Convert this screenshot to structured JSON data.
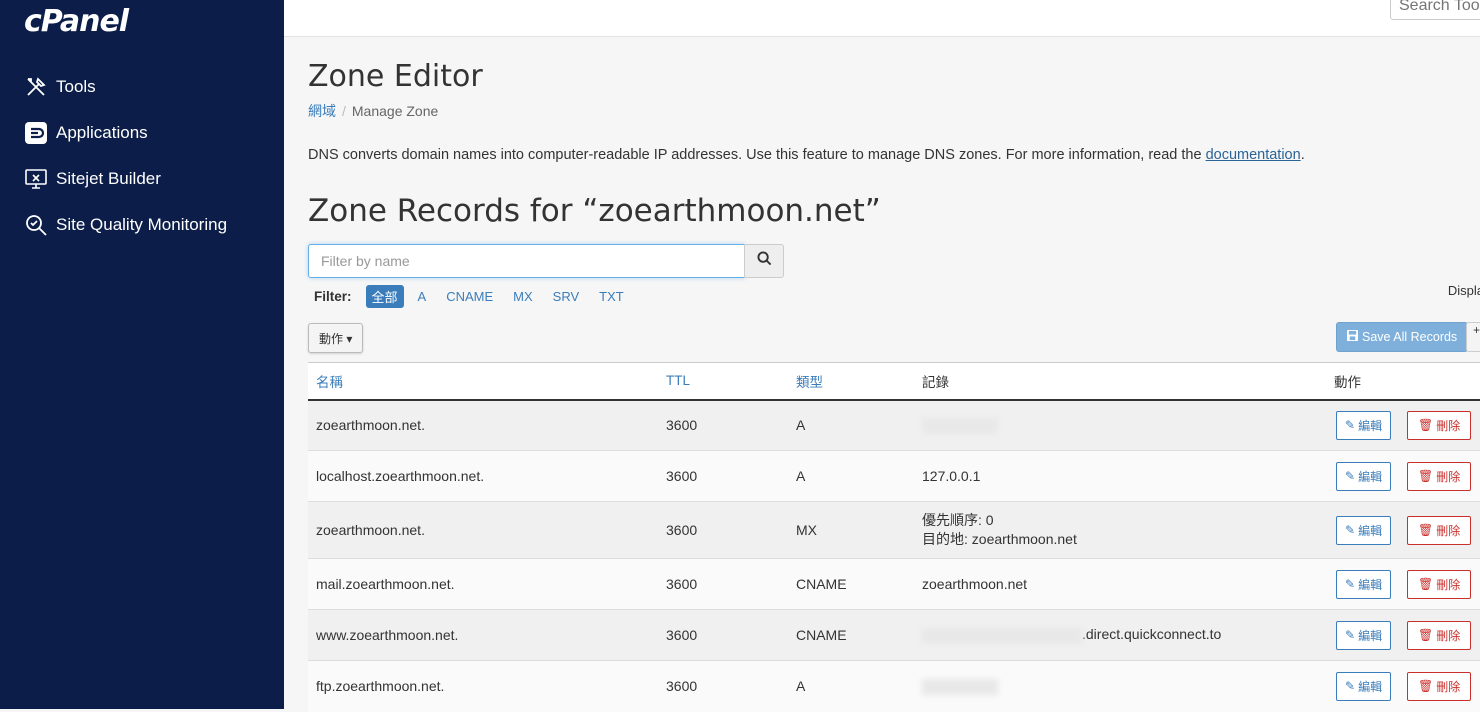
{
  "sidebar": {
    "logo": "cPanel",
    "items": [
      {
        "label": "Tools",
        "icon": "tools-icon"
      },
      {
        "label": "Applications",
        "icon": "applications-icon"
      },
      {
        "label": "Sitejet Builder",
        "icon": "sitejet-icon"
      },
      {
        "label": "Site Quality Monitoring",
        "icon": "site-quality-icon"
      }
    ]
  },
  "topbar": {
    "search_placeholder": "Search Tools"
  },
  "page": {
    "title": "Zone Editor",
    "breadcrumb": {
      "parent": "網域",
      "current": "Manage Zone"
    },
    "description": "DNS converts domain names into computer-readable IP addresses. Use this feature to manage DNS zones. For more information, read the ",
    "doc_link": "documentation",
    "desc_end": ".",
    "zone_title": "Zone Records for “zoearthmoon.net”"
  },
  "filter": {
    "placeholder": "Filter by name",
    "label": "Filter:",
    "chips": [
      "全部",
      "A",
      "CNAME",
      "MX",
      "SRV",
      "TXT"
    ],
    "display_text": "Displa"
  },
  "toolbar": {
    "action_label": "動作",
    "save_label": "Save All Records"
  },
  "table": {
    "headers": {
      "name": "名稱",
      "ttl": "TTL",
      "type": "類型",
      "record": "記錄",
      "actions": "動作"
    },
    "edit_label": "編輯",
    "delete_label": "刪除",
    "rows": [
      {
        "name": "zoearthmoon.net.",
        "ttl": "3600",
        "type": "A",
        "record": ""
      },
      {
        "name": "localhost.zoearthmoon.net.",
        "ttl": "3600",
        "type": "A",
        "record": "127.0.0.1"
      },
      {
        "name": "zoearthmoon.net.",
        "ttl": "3600",
        "type": "MX",
        "priority_label": "優先順序:",
        "priority": "0",
        "dest_label": "目的地:",
        "dest": "zoearthmoon.net"
      },
      {
        "name": "mail.zoearthmoon.net.",
        "ttl": "3600",
        "type": "CNAME",
        "record": "zoearthmoon.net"
      },
      {
        "name": "www.zoearthmoon.net.",
        "ttl": "3600",
        "type": "CNAME",
        "record": ".direct.quickconnect.to"
      },
      {
        "name": "ftp.zoearthmoon.net.",
        "ttl": "3600",
        "type": "A",
        "record": ""
      }
    ]
  }
}
